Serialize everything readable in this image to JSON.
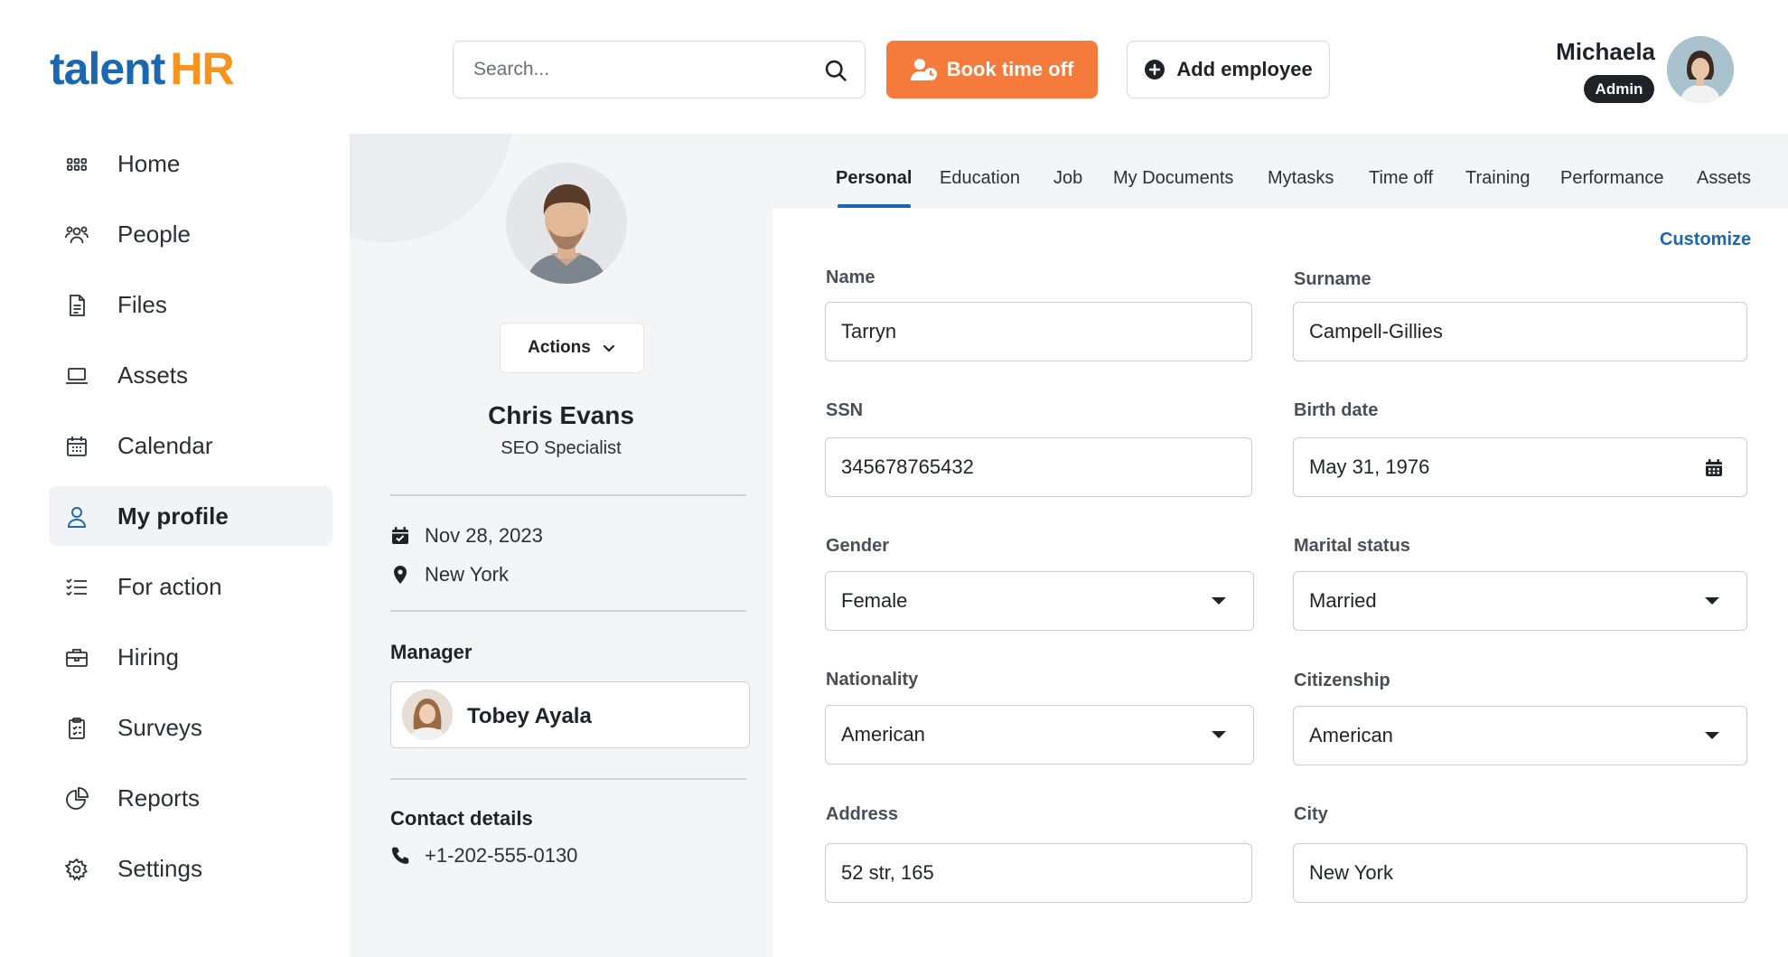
{
  "brand": {
    "part1": "talent",
    "part2": "HR"
  },
  "header": {
    "search_placeholder": "Search...",
    "book_label": "Book time off",
    "add_label": "Add employee",
    "user_name": "Michaela",
    "user_role": "Admin"
  },
  "sidebar": {
    "items": [
      {
        "label": "Home",
        "icon": "grid-icon"
      },
      {
        "label": "People",
        "icon": "people-icon"
      },
      {
        "label": "Files",
        "icon": "file-icon"
      },
      {
        "label": "Assets",
        "icon": "laptop-icon"
      },
      {
        "label": "Calendar",
        "icon": "calendar-icon"
      },
      {
        "label": "My profile",
        "icon": "user-icon",
        "active": true
      },
      {
        "label": "For action",
        "icon": "checklist-icon"
      },
      {
        "label": "Hiring",
        "icon": "briefcase-icon"
      },
      {
        "label": "Surveys",
        "icon": "clipboard-icon"
      },
      {
        "label": "Reports",
        "icon": "pie-chart-icon"
      },
      {
        "label": "Settings",
        "icon": "gear-icon"
      }
    ]
  },
  "profile": {
    "actions_label": "Actions",
    "name": "Chris Evans",
    "title": "SEO Specialist",
    "date": "Nov 28, 2023",
    "location": "New York",
    "manager_heading": "Manager",
    "manager_name": "Tobey Ayala",
    "contact_heading": "Contact details",
    "phone": "+1-202-555-0130"
  },
  "tabs": [
    "Personal",
    "Education",
    "Job",
    "My Documents",
    "Mytasks",
    "Time off",
    "Training",
    "Performance",
    "Assets"
  ],
  "form": {
    "customize_label": "Customize",
    "name_label": "Name",
    "name_value": "Tarryn",
    "surname_label": "Surname",
    "surname_value": "Campell-Gillies",
    "ssn_label": "SSN",
    "ssn_value": "345678765432",
    "birth_label": "Birth date",
    "birth_value": "May 31, 1976",
    "gender_label": "Gender",
    "gender_value": "Female",
    "marital_label": "Marital status",
    "marital_value": "Married",
    "nationality_label": "Nationality",
    "nationality_value": "American",
    "citizenship_label": "Citizenship",
    "citizenship_value": "American",
    "address_label": "Address",
    "address_value": "52 str, 165",
    "city_label": "City",
    "city_value": "New York"
  },
  "colors": {
    "brand_blue": "#1b68b0",
    "brand_orange": "#f7931e",
    "book_button": "#f47b3c"
  }
}
